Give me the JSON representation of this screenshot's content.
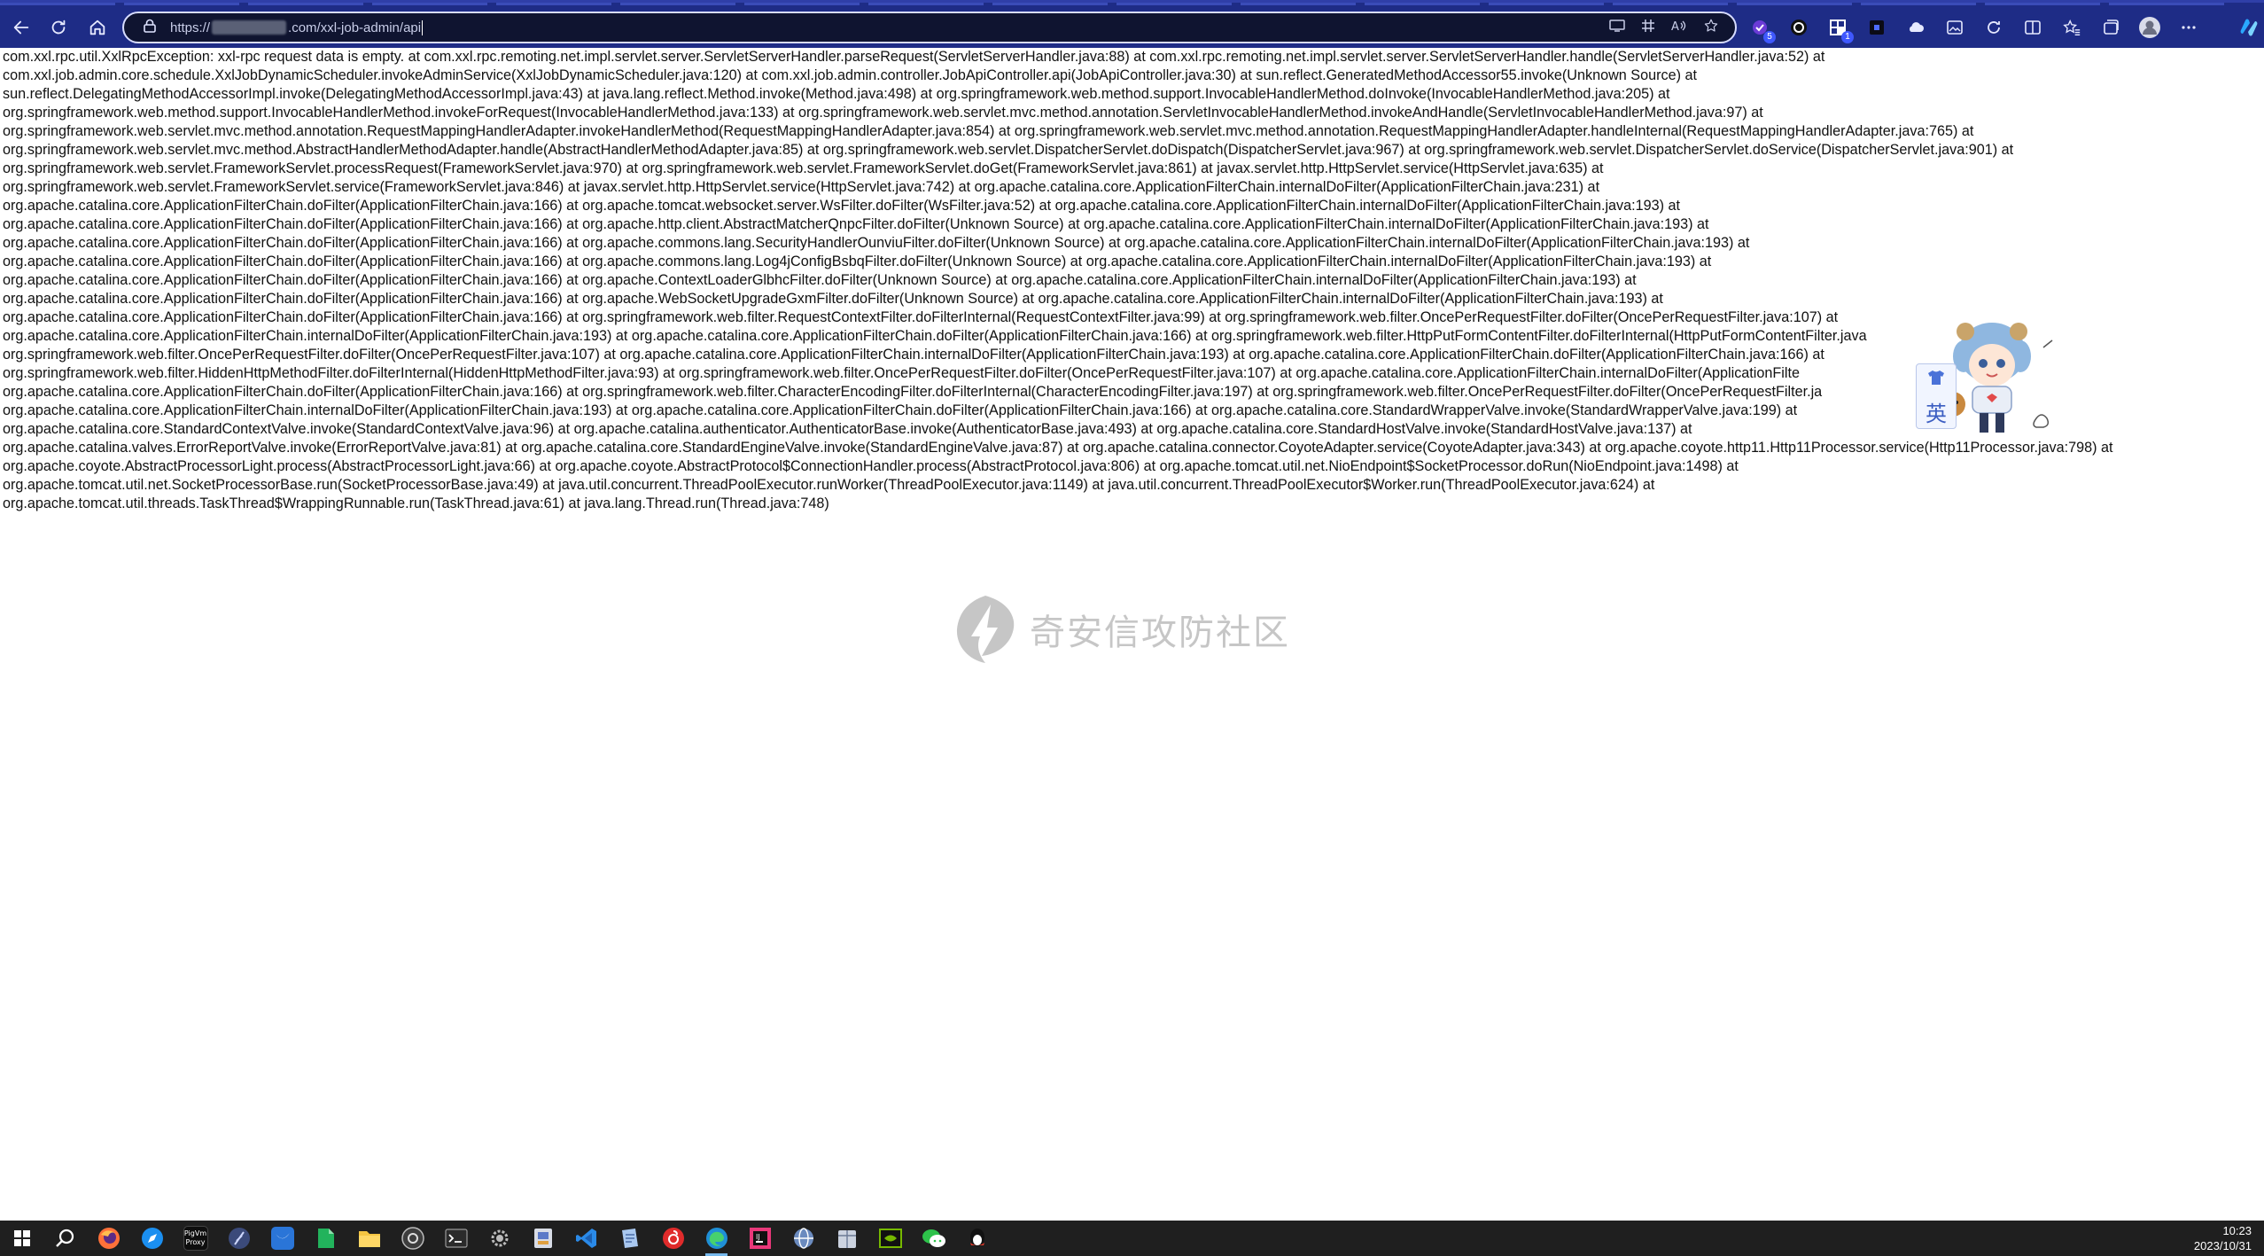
{
  "browser": {
    "url_prefix": "https://",
    "url_suffix": ".com/xxl-job-admin/api",
    "nav": {
      "back_icon": "arrow-left-icon",
      "refresh_icon": "refresh-icon",
      "home_icon": "home-icon"
    },
    "ext_badges": {
      "ext1": "5",
      "ext3": "1"
    }
  },
  "page": {
    "stack_trace": [
      "com.xxl.rpc.util.XxlRpcException: xxl-rpc request data is empty. at com.xxl.rpc.remoting.net.impl.servlet.server.ServletServerHandler.parseRequest(ServletServerHandler.java:88) at com.xxl.rpc.remoting.net.impl.servlet.server.ServletServerHandler.handle(ServletServerHandler.java:52) at",
      "com.xxl.job.admin.core.schedule.XxlJobDynamicScheduler.invokeAdminService(XxlJobDynamicScheduler.java:120) at com.xxl.job.admin.controller.JobApiController.api(JobApiController.java:30) at sun.reflect.GeneratedMethodAccessor55.invoke(Unknown Source) at",
      "sun.reflect.DelegatingMethodAccessorImpl.invoke(DelegatingMethodAccessorImpl.java:43) at java.lang.reflect.Method.invoke(Method.java:498) at org.springframework.web.method.support.InvocableHandlerMethod.doInvoke(InvocableHandlerMethod.java:205) at",
      "org.springframework.web.method.support.InvocableHandlerMethod.invokeForRequest(InvocableHandlerMethod.java:133) at org.springframework.web.servlet.mvc.method.annotation.ServletInvocableHandlerMethod.invokeAndHandle(ServletInvocableHandlerMethod.java:97) at",
      "org.springframework.web.servlet.mvc.method.annotation.RequestMappingHandlerAdapter.invokeHandlerMethod(RequestMappingHandlerAdapter.java:854) at org.springframework.web.servlet.mvc.method.annotation.RequestMappingHandlerAdapter.handleInternal(RequestMappingHandlerAdapter.java:765) at",
      "org.springframework.web.servlet.mvc.method.AbstractHandlerMethodAdapter.handle(AbstractHandlerMethodAdapter.java:85) at org.springframework.web.servlet.DispatcherServlet.doDispatch(DispatcherServlet.java:967) at org.springframework.web.servlet.DispatcherServlet.doService(DispatcherServlet.java:901) at",
      "org.springframework.web.servlet.FrameworkServlet.processRequest(FrameworkServlet.java:970) at org.springframework.web.servlet.FrameworkServlet.doGet(FrameworkServlet.java:861) at javax.servlet.http.HttpServlet.service(HttpServlet.java:635) at",
      "org.springframework.web.servlet.FrameworkServlet.service(FrameworkServlet.java:846) at javax.servlet.http.HttpServlet.service(HttpServlet.java:742) at org.apache.catalina.core.ApplicationFilterChain.internalDoFilter(ApplicationFilterChain.java:231) at",
      "org.apache.catalina.core.ApplicationFilterChain.doFilter(ApplicationFilterChain.java:166) at org.apache.tomcat.websocket.server.WsFilter.doFilter(WsFilter.java:52) at org.apache.catalina.core.ApplicationFilterChain.internalDoFilter(ApplicationFilterChain.java:193) at",
      "org.apache.catalina.core.ApplicationFilterChain.doFilter(ApplicationFilterChain.java:166) at org.apache.http.client.AbstractMatcherQnpcFilter.doFilter(Unknown Source) at org.apache.catalina.core.ApplicationFilterChain.internalDoFilter(ApplicationFilterChain.java:193) at",
      "org.apache.catalina.core.ApplicationFilterChain.doFilter(ApplicationFilterChain.java:166) at org.apache.commons.lang.SecurityHandlerOunviuFilter.doFilter(Unknown Source) at org.apache.catalina.core.ApplicationFilterChain.internalDoFilter(ApplicationFilterChain.java:193) at",
      "org.apache.catalina.core.ApplicationFilterChain.doFilter(ApplicationFilterChain.java:166) at org.apache.commons.lang.Log4jConfigBsbqFilter.doFilter(Unknown Source) at org.apache.catalina.core.ApplicationFilterChain.internalDoFilter(ApplicationFilterChain.java:193) at",
      "org.apache.catalina.core.ApplicationFilterChain.doFilter(ApplicationFilterChain.java:166) at org.apache.ContextLoaderGlbhcFilter.doFilter(Unknown Source) at org.apache.catalina.core.ApplicationFilterChain.internalDoFilter(ApplicationFilterChain.java:193) at",
      "org.apache.catalina.core.ApplicationFilterChain.doFilter(ApplicationFilterChain.java:166) at org.apache.WebSocketUpgradeGxmFilter.doFilter(Unknown Source) at org.apache.catalina.core.ApplicationFilterChain.internalDoFilter(ApplicationFilterChain.java:193) at",
      "org.apache.catalina.core.ApplicationFilterChain.doFilter(ApplicationFilterChain.java:166) at org.springframework.web.filter.RequestContextFilter.doFilterInternal(RequestContextFilter.java:99) at org.springframework.web.filter.OncePerRequestFilter.doFilter(OncePerRequestFilter.java:107) at",
      "org.apache.catalina.core.ApplicationFilterChain.internalDoFilter(ApplicationFilterChain.java:193) at org.apache.catalina.core.ApplicationFilterChain.doFilter(ApplicationFilterChain.java:166) at org.springframework.web.filter.HttpPutFormContentFilter.doFilterInternal(HttpPutFormContentFilter.java",
      "org.springframework.web.filter.OncePerRequestFilter.doFilter(OncePerRequestFilter.java:107) at org.apache.catalina.core.ApplicationFilterChain.internalDoFilter(ApplicationFilterChain.java:193) at org.apache.catalina.core.ApplicationFilterChain.doFilter(ApplicationFilterChain.java:166) at",
      "org.springframework.web.filter.HiddenHttpMethodFilter.doFilterInternal(HiddenHttpMethodFilter.java:93) at org.springframework.web.filter.OncePerRequestFilter.doFilter(OncePerRequestFilter.java:107) at org.apache.catalina.core.ApplicationFilterChain.internalDoFilter(ApplicationFilte",
      "org.apache.catalina.core.ApplicationFilterChain.doFilter(ApplicationFilterChain.java:166) at org.springframework.web.filter.CharacterEncodingFilter.doFilterInternal(CharacterEncodingFilter.java:197) at org.springframework.web.filter.OncePerRequestFilter.doFilter(OncePerRequestFilter.ja",
      "org.apache.catalina.core.ApplicationFilterChain.internalDoFilter(ApplicationFilterChain.java:193) at org.apache.catalina.core.ApplicationFilterChain.doFilter(ApplicationFilterChain.java:166) at org.apache.catalina.core.StandardWrapperValve.invoke(StandardWrapperValve.java:199) at",
      "org.apache.catalina.core.StandardContextValve.invoke(StandardContextValve.java:96) at org.apache.catalina.authenticator.AuthenticatorBase.invoke(AuthenticatorBase.java:493) at org.apache.catalina.core.StandardHostValve.invoke(StandardHostValve.java:137) at",
      "org.apache.catalina.valves.ErrorReportValve.invoke(ErrorReportValve.java:81) at org.apache.catalina.core.StandardEngineValve.invoke(StandardEngineValve.java:87) at org.apache.catalina.connector.CoyoteAdapter.service(CoyoteAdapter.java:343) at org.apache.coyote.http11.Http11Processor.service(Http11Processor.java:798) at",
      "org.apache.coyote.AbstractProcessorLight.process(AbstractProcessorLight.java:66) at org.apache.coyote.AbstractProtocol$ConnectionHandler.process(AbstractProtocol.java:806) at org.apache.tomcat.util.net.NioEndpoint$SocketProcessor.doRun(NioEndpoint.java:1498) at",
      "org.apache.tomcat.util.net.SocketProcessorBase.run(SocketProcessorBase.java:49) at java.util.concurrent.ThreadPoolExecutor.runWorker(ThreadPoolExecutor.java:1149) at java.util.concurrent.ThreadPoolExecutor$Worker.run(ThreadPoolExecutor.java:624) at",
      "org.apache.tomcat.util.threads.TaskThread$WrappingRunnable.run(TaskThread.java:61) at java.lang.Thread.run(Thread.java:748)"
    ],
    "watermark": "奇安信攻防社区"
  },
  "ime": {
    "mode_label": "英"
  },
  "taskbar": {
    "clock_time": "10:23",
    "clock_date": "2023/10/31",
    "pin_label_proxy": "Proxy",
    "pin_label_proxy_top": "PigVm"
  },
  "colors": {
    "browser_chrome": "#1e2c86",
    "taskbar": "#1f1f1f",
    "text": "#111111",
    "watermark": "#8f8f8f"
  }
}
